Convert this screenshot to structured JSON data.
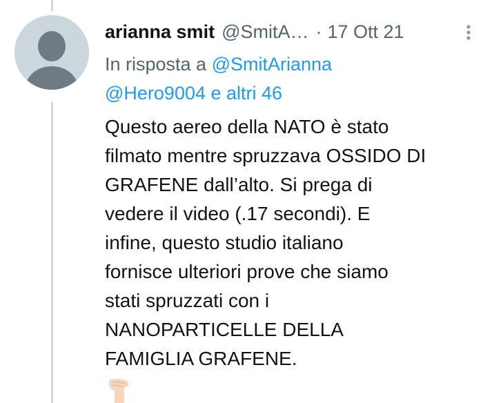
{
  "tweet": {
    "author_name": "arianna smit",
    "author_handle": "@SmitA…",
    "separator": "·",
    "date": "17 Ott 21",
    "more_icon": "more-vertical-icon",
    "reply_prefix": "In risposta a",
    "reply_mention_1": "@SmitArianna",
    "reply_mention_2": "@Hero9004 e altri 46",
    "body_lines": [
      "Questo aereo della NATO è stato",
      "filmato mentre spruzzava OSSIDO DI",
      "GRAFENE dall’alto. Si prega di",
      "vedere il video (.17 secondi). E",
      "infine, questo studio italiano",
      "fornisce ulteriori prove che siamo",
      "stati spruzzati con i",
      "NANOPARTICELLE DELLA",
      "FAMIGLIA GRAFENE."
    ],
    "trailing_emoji": "pointing-down-hand-emoji"
  },
  "colors": {
    "text_primary": "#0f1419",
    "text_secondary": "#536471",
    "link": "#1d9bf0",
    "avatar_bg": "#ccd6dd",
    "avatar_fg": "#6e7b85",
    "thread_line": "#cfd9de"
  }
}
